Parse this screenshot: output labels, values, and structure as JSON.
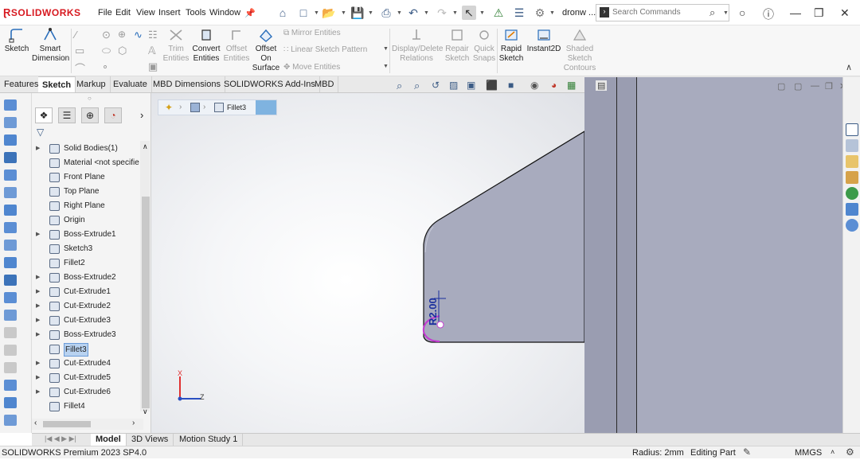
{
  "app": {
    "logo": "SOLIDWORKS",
    "doc_name": "dronw ..."
  },
  "menu": [
    "File",
    "Edit",
    "View",
    "Insert",
    "Tools",
    "Window"
  ],
  "search": {
    "placeholder": "Search Commands"
  },
  "command_manager": {
    "sketch": "Sketch",
    "smart_dimension": [
      "Smart",
      "Dimension"
    ],
    "trim": [
      "Trim",
      "Entities"
    ],
    "convert": [
      "Convert",
      "Entities"
    ],
    "offset": [
      "Offset",
      "Entities"
    ],
    "offset_surface": [
      "Offset",
      "On",
      "Surface"
    ],
    "mirror": "Mirror Entities",
    "linear_pattern": "Linear Sketch Pattern",
    "move": "Move Entities",
    "display_delete": [
      "Display/Delete",
      "Relations"
    ],
    "repair": [
      "Repair",
      "Sketch"
    ],
    "quick_snaps": [
      "Quick",
      "Snaps"
    ],
    "rapid_sketch": [
      "Rapid",
      "Sketch"
    ],
    "instant2d": "Instant2D",
    "shaded_contours": [
      "Shaded",
      "Sketch",
      "Contours"
    ]
  },
  "tabs": [
    "Features",
    "Sketch",
    "Markup",
    "Evaluate",
    "MBD Dimensions",
    "SOLIDWORKS Add-Ins",
    "MBD"
  ],
  "active_tab": "Sketch",
  "tree": [
    {
      "label": "Solid Bodies(1)",
      "expandable": true
    },
    {
      "label": "Material <not specifie",
      "expandable": false
    },
    {
      "label": "Front Plane",
      "expandable": false
    },
    {
      "label": "Top Plane",
      "expandable": false
    },
    {
      "label": "Right Plane",
      "expandable": false
    },
    {
      "label": "Origin",
      "expandable": false
    },
    {
      "label": "Boss-Extrude1",
      "expandable": true
    },
    {
      "label": "Sketch3",
      "expandable": false
    },
    {
      "label": "Fillet2",
      "expandable": false
    },
    {
      "label": "Boss-Extrude2",
      "expandable": true
    },
    {
      "label": "Cut-Extrude1",
      "expandable": true
    },
    {
      "label": "Cut-Extrude2",
      "expandable": true
    },
    {
      "label": "Cut-Extrude3",
      "expandable": true
    },
    {
      "label": "Boss-Extrude3",
      "expandable": true
    },
    {
      "label": "Fillet3",
      "expandable": false,
      "selected": true
    },
    {
      "label": "Cut-Extrude4",
      "expandable": true
    },
    {
      "label": "Cut-Extrude5",
      "expandable": true
    },
    {
      "label": "Cut-Extrude6",
      "expandable": true
    },
    {
      "label": "Fillet4",
      "expandable": false
    }
  ],
  "breadcrumb": {
    "item": "Fillet3"
  },
  "viewport": {
    "dimension_label": "R2.00",
    "triad_x": "X",
    "triad_z": "Z"
  },
  "bottom_tabs": [
    "Model",
    "3D Views",
    "Motion Study 1"
  ],
  "status": {
    "product": "SOLIDWORKS Premium 2023 SP4.0",
    "radius": "Radius: 2mm",
    "mode": "Editing Part",
    "units": "MMGS"
  },
  "colors": {
    "accent": "#d71920",
    "selection": "#b8d2f0",
    "model_face": "#a8abbe",
    "dimension": "#1a2f9e",
    "fillet_arc": "#c43bd1"
  }
}
